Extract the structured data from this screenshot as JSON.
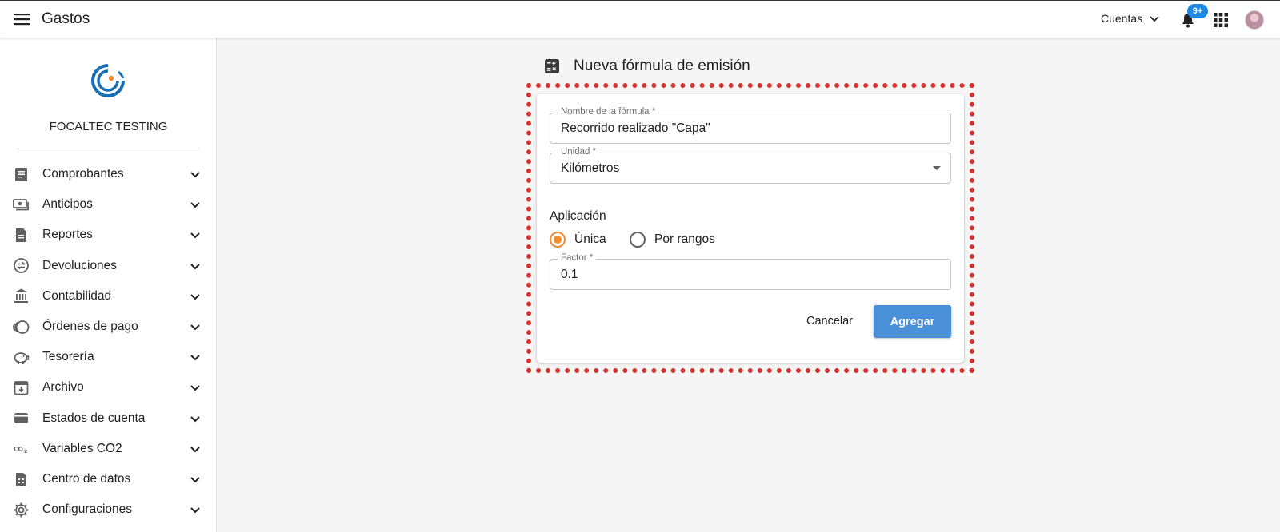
{
  "app": {
    "title": "Gastos"
  },
  "header": {
    "accounts_label": "Cuentas",
    "notification_badge": "9+"
  },
  "sidebar": {
    "org_name": "FOCALTEC TESTING",
    "items": [
      {
        "label": "Comprobantes",
        "icon": "receipt-icon"
      },
      {
        "label": "Anticipos",
        "icon": "cash-icon"
      },
      {
        "label": "Reportes",
        "icon": "report-icon"
      },
      {
        "label": "Devoluciones",
        "icon": "exchange-icon"
      },
      {
        "label": "Contabilidad",
        "icon": "bank-icon"
      },
      {
        "label": "Órdenes de pago",
        "icon": "coins-icon"
      },
      {
        "label": "Tesorería",
        "icon": "piggy-bank-icon"
      },
      {
        "label": "Archivo",
        "icon": "archive-icon"
      },
      {
        "label": "Estados de cuenta",
        "icon": "wallet-icon"
      },
      {
        "label": "Variables CO2",
        "icon": "co2-icon"
      },
      {
        "label": "Centro de datos",
        "icon": "data-center-icon"
      },
      {
        "label": "Configuraciones",
        "icon": "gear-icon"
      }
    ]
  },
  "form": {
    "title": "Nueva fórmula de emisión",
    "name_field": {
      "label": "Nombre de la fórmula *",
      "value": "Recorrido realizado \"Capa\""
    },
    "unit_field": {
      "label": "Unidad *",
      "value": "Kilómetros"
    },
    "application": {
      "label": "Aplicación",
      "options": [
        "Única",
        "Por rangos"
      ],
      "selected": "Única"
    },
    "factor_field": {
      "label": "Factor *",
      "value": "0.1"
    },
    "cancel_label": "Cancelar",
    "submit_label": "Agregar"
  },
  "colors": {
    "accent": "#4a90d9",
    "radio_selected": "#f28a30",
    "highlight": "#d9322e",
    "badge": "#1e88e5"
  }
}
